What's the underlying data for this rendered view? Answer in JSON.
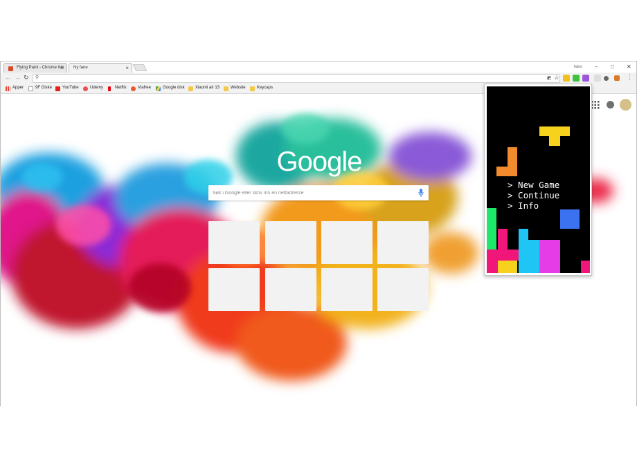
{
  "tabs": [
    {
      "title": "Flying Paint - Chrome We",
      "close": "×",
      "favicon_color": "#d84a2a"
    },
    {
      "title": "Ny fane",
      "close": "×",
      "favicon_color": "#ffffff"
    }
  ],
  "user_label": "Ildikó",
  "window_controls": {
    "minimize": "–",
    "maximize": "□",
    "close": "✕"
  },
  "toolbar": {
    "back": "←",
    "forward": "→",
    "reload": "↻",
    "search_glyph": "⚲",
    "star": "☆",
    "menu": "⋮",
    "omnibox_value": ""
  },
  "extension_colors": [
    "#f0c020",
    "#3ec33e",
    "#9b59d8",
    "#cccccc",
    "#555555",
    "#d87a2a"
  ],
  "bookmarks": [
    {
      "label": "Apper",
      "icon": "apps-grid-icon",
      "color": "#e24b3b"
    },
    {
      "label": "9F Giske",
      "icon": "page-icon",
      "color": "#9a9a9a"
    },
    {
      "label": "YouTube",
      "icon": "youtube-icon",
      "color": "#e62117"
    },
    {
      "label": "Udemy",
      "icon": "udemy-icon",
      "color": "#ec5252"
    },
    {
      "label": "Netflix",
      "icon": "netflix-icon",
      "color": "#e50914"
    },
    {
      "label": "Viafree",
      "icon": "viafree-icon",
      "color": "#e55a2b"
    },
    {
      "label": "Google disk",
      "icon": "drive-icon",
      "color": "#1fa463"
    },
    {
      "label": "Xiaomi air 13",
      "icon": "folder-icon",
      "color": "#f2c94c"
    },
    {
      "label": "Website",
      "icon": "folder-icon",
      "color": "#f2c94c"
    },
    {
      "label": "Keycaps",
      "icon": "folder-icon",
      "color": "#f2c94c"
    }
  ],
  "newtab": {
    "logo": "Google",
    "search_placeholder": "Søk i Google eller skriv inn en nettadresse",
    "tiles_count": 8
  },
  "tetris": {
    "menu": [
      "> New Game",
      "> Continue",
      "> Info"
    ],
    "colors": {
      "yellow": "#f7d21c",
      "orange": "#f28b2d",
      "green": "#1ee86a",
      "blue": "#3a72f0",
      "cyan": "#1fc6f5",
      "magenta": "#e63ce8",
      "pink": "#f0167a"
    }
  }
}
